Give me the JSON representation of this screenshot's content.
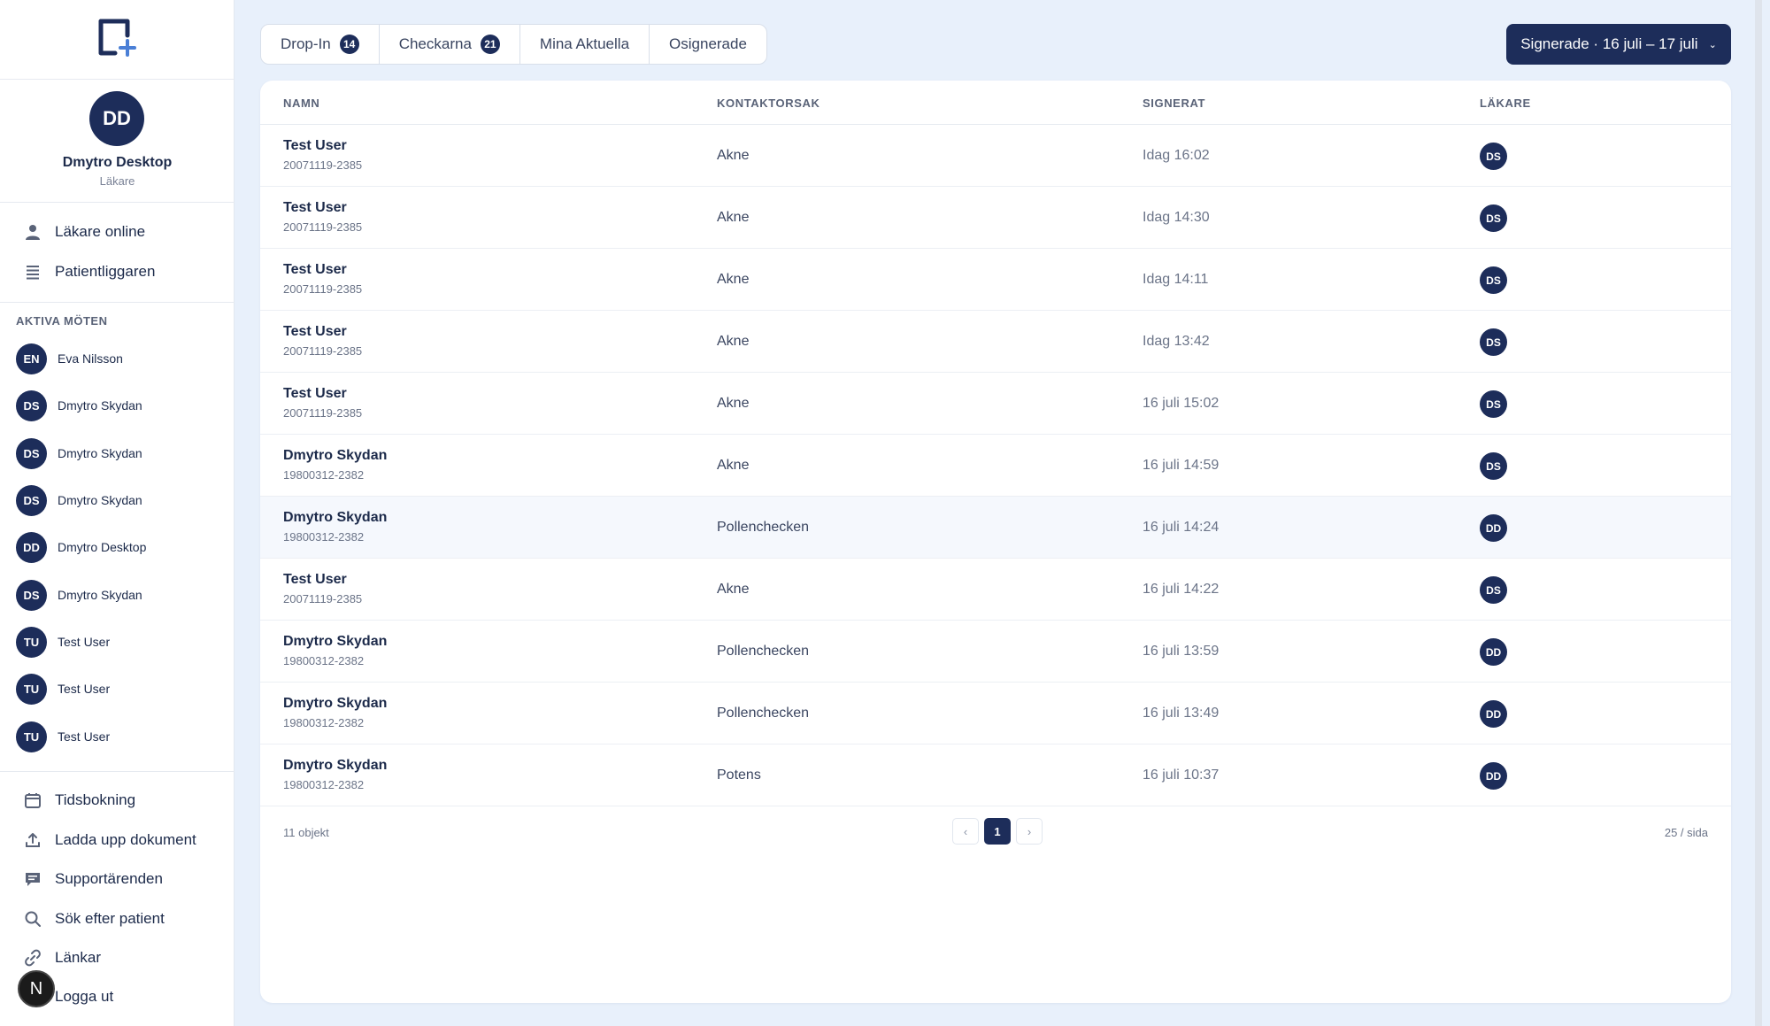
{
  "user": {
    "initials": "DD",
    "name": "Dmytro Desktop",
    "role": "Läkare"
  },
  "nav_top": [
    {
      "label": "Läkare online",
      "icon": "person-icon"
    },
    {
      "label": "Patientliggaren",
      "icon": "list-icon"
    }
  ],
  "active_meetings": {
    "title": "AKTIVA MÖTEN",
    "items": [
      {
        "initials": "EN",
        "name": "Eva Nilsson"
      },
      {
        "initials": "DS",
        "name": "Dmytro Skydan"
      },
      {
        "initials": "DS",
        "name": "Dmytro Skydan"
      },
      {
        "initials": "DS",
        "name": "Dmytro Skydan"
      },
      {
        "initials": "DD",
        "name": "Dmytro Desktop"
      },
      {
        "initials": "DS",
        "name": "Dmytro Skydan"
      },
      {
        "initials": "TU",
        "name": "Test User"
      },
      {
        "initials": "TU",
        "name": "Test User"
      },
      {
        "initials": "TU",
        "name": "Test User"
      }
    ]
  },
  "nav_bottom": [
    {
      "label": "Tidsbokning",
      "icon": "calendar-icon"
    },
    {
      "label": "Ladda upp dokument",
      "icon": "upload-icon"
    },
    {
      "label": "Supportärenden",
      "icon": "chat-icon"
    },
    {
      "label": "Sök efter patient",
      "icon": "search-icon"
    },
    {
      "label": "Länkar",
      "icon": "link-icon"
    },
    {
      "label": "Logga ut",
      "icon": "logout-icon"
    }
  ],
  "n_badge": "N",
  "tabs": [
    {
      "label": "Drop-In",
      "count": "14"
    },
    {
      "label": "Checkarna",
      "count": "21"
    },
    {
      "label": "Mina Aktuella",
      "count": ""
    },
    {
      "label": "Osignerade",
      "count": ""
    }
  ],
  "filter": {
    "label": "Signerade · 16 juli – 17 juli",
    "chevron": "⌄"
  },
  "table": {
    "headers": {
      "name": "NAMN",
      "reason": "KONTAKTORSAK",
      "signed": "SIGNERAT",
      "doctor": "LÄKARE"
    },
    "rows": [
      {
        "name": "Test User",
        "pnr": "20071119-2385",
        "reason": "Akne",
        "signed": "Idag 16:02",
        "doctor": "DS"
      },
      {
        "name": "Test User",
        "pnr": "20071119-2385",
        "reason": "Akne",
        "signed": "Idag 14:30",
        "doctor": "DS"
      },
      {
        "name": "Test User",
        "pnr": "20071119-2385",
        "reason": "Akne",
        "signed": "Idag 14:11",
        "doctor": "DS"
      },
      {
        "name": "Test User",
        "pnr": "20071119-2385",
        "reason": "Akne",
        "signed": "Idag 13:42",
        "doctor": "DS"
      },
      {
        "name": "Test User",
        "pnr": "20071119-2385",
        "reason": "Akne",
        "signed": "16 juli 15:02",
        "doctor": "DS"
      },
      {
        "name": "Dmytro Skydan",
        "pnr": "19800312-2382",
        "reason": "Akne",
        "signed": "16 juli 14:59",
        "doctor": "DS"
      },
      {
        "name": "Dmytro Skydan",
        "pnr": "19800312-2382",
        "reason": "Pollenchecken",
        "signed": "16 juli 14:24",
        "doctor": "DD"
      },
      {
        "name": "Test User",
        "pnr": "20071119-2385",
        "reason": "Akne",
        "signed": "16 juli 14:22",
        "doctor": "DS"
      },
      {
        "name": "Dmytro Skydan",
        "pnr": "19800312-2382",
        "reason": "Pollenchecken",
        "signed": "16 juli 13:59",
        "doctor": "DD"
      },
      {
        "name": "Dmytro Skydan",
        "pnr": "19800312-2382",
        "reason": "Pollenchecken",
        "signed": "16 juli 13:49",
        "doctor": "DD"
      },
      {
        "name": "Dmytro Skydan",
        "pnr": "19800312-2382",
        "reason": "Potens",
        "signed": "16 juli 10:37",
        "doctor": "DD"
      }
    ],
    "highlighted_row": 6
  },
  "pagination": {
    "count_label": "11 objekt",
    "prev": "‹",
    "page": "1",
    "next": "›",
    "per_page": "25 / sida"
  },
  "colors": {
    "accent": "#1d2d5a",
    "background": "#e8f0fb"
  }
}
